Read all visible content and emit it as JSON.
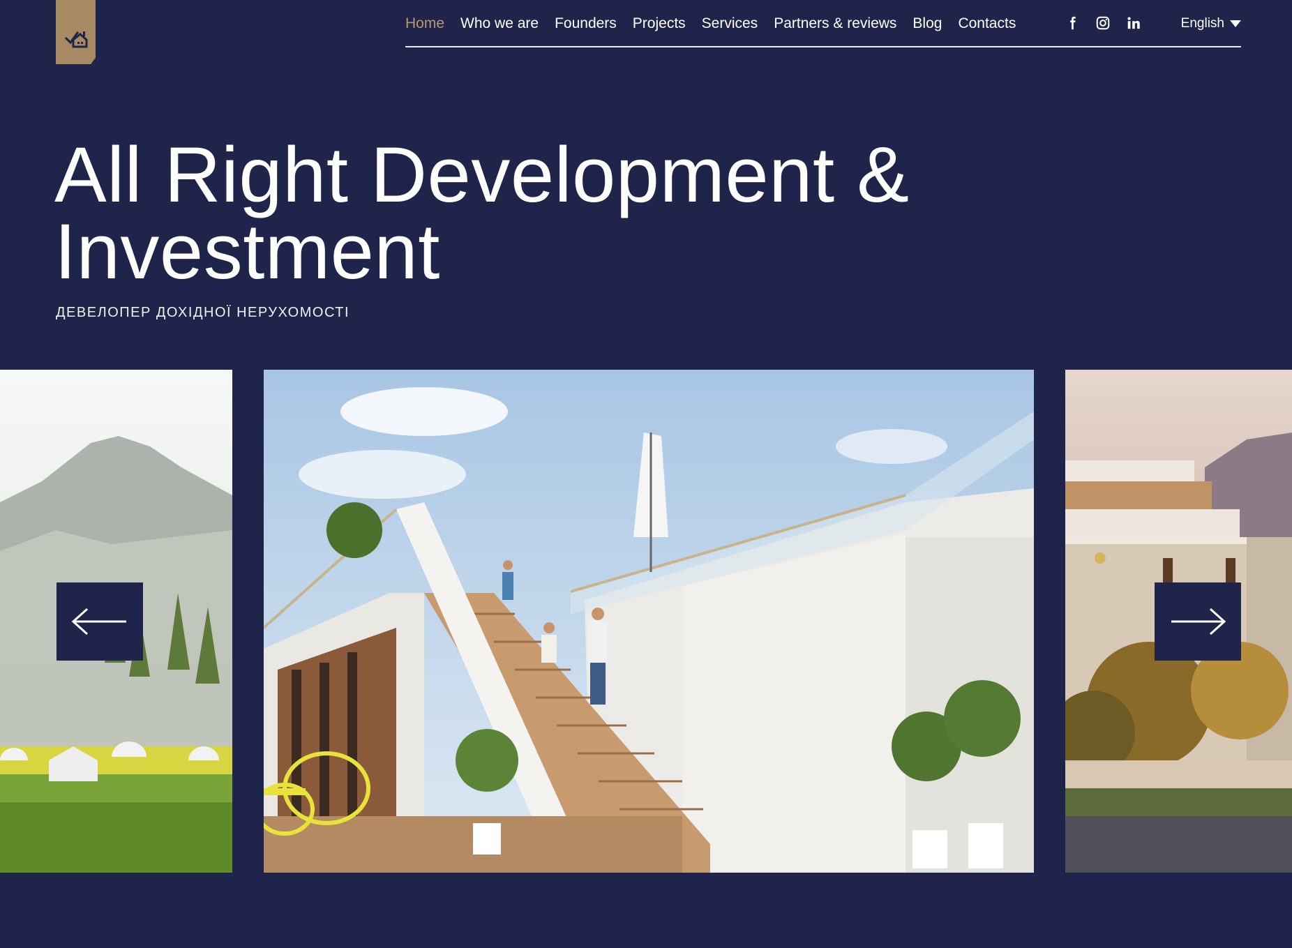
{
  "brand": {
    "logo_icon": "house-check-logo",
    "accent": "#a78a63"
  },
  "nav": {
    "items": [
      {
        "label": "Home",
        "active": true
      },
      {
        "label": "Who we are",
        "active": false
      },
      {
        "label": "Founders",
        "active": false
      },
      {
        "label": "Projects",
        "active": false
      },
      {
        "label": "Services",
        "active": false
      },
      {
        "label": "Partners & reviews",
        "active": false
      },
      {
        "label": "Blog",
        "active": false
      },
      {
        "label": "Contacts",
        "active": false
      }
    ],
    "socials": [
      "facebook-icon",
      "instagram-icon",
      "linkedin-icon"
    ],
    "language": "English"
  },
  "hero": {
    "title_line1": "All Right Development &",
    "title_line2": "Investment",
    "subtitle": "ДЕВЕЛОПЕР ДОХІДНОЇ НЕРУХОМОСТІ"
  },
  "slider": {
    "prev_icon": "arrow-left-icon",
    "next_icon": "arrow-right-icon"
  },
  "colors": {
    "background": "#1f254a",
    "active_nav": "#b79a72"
  }
}
